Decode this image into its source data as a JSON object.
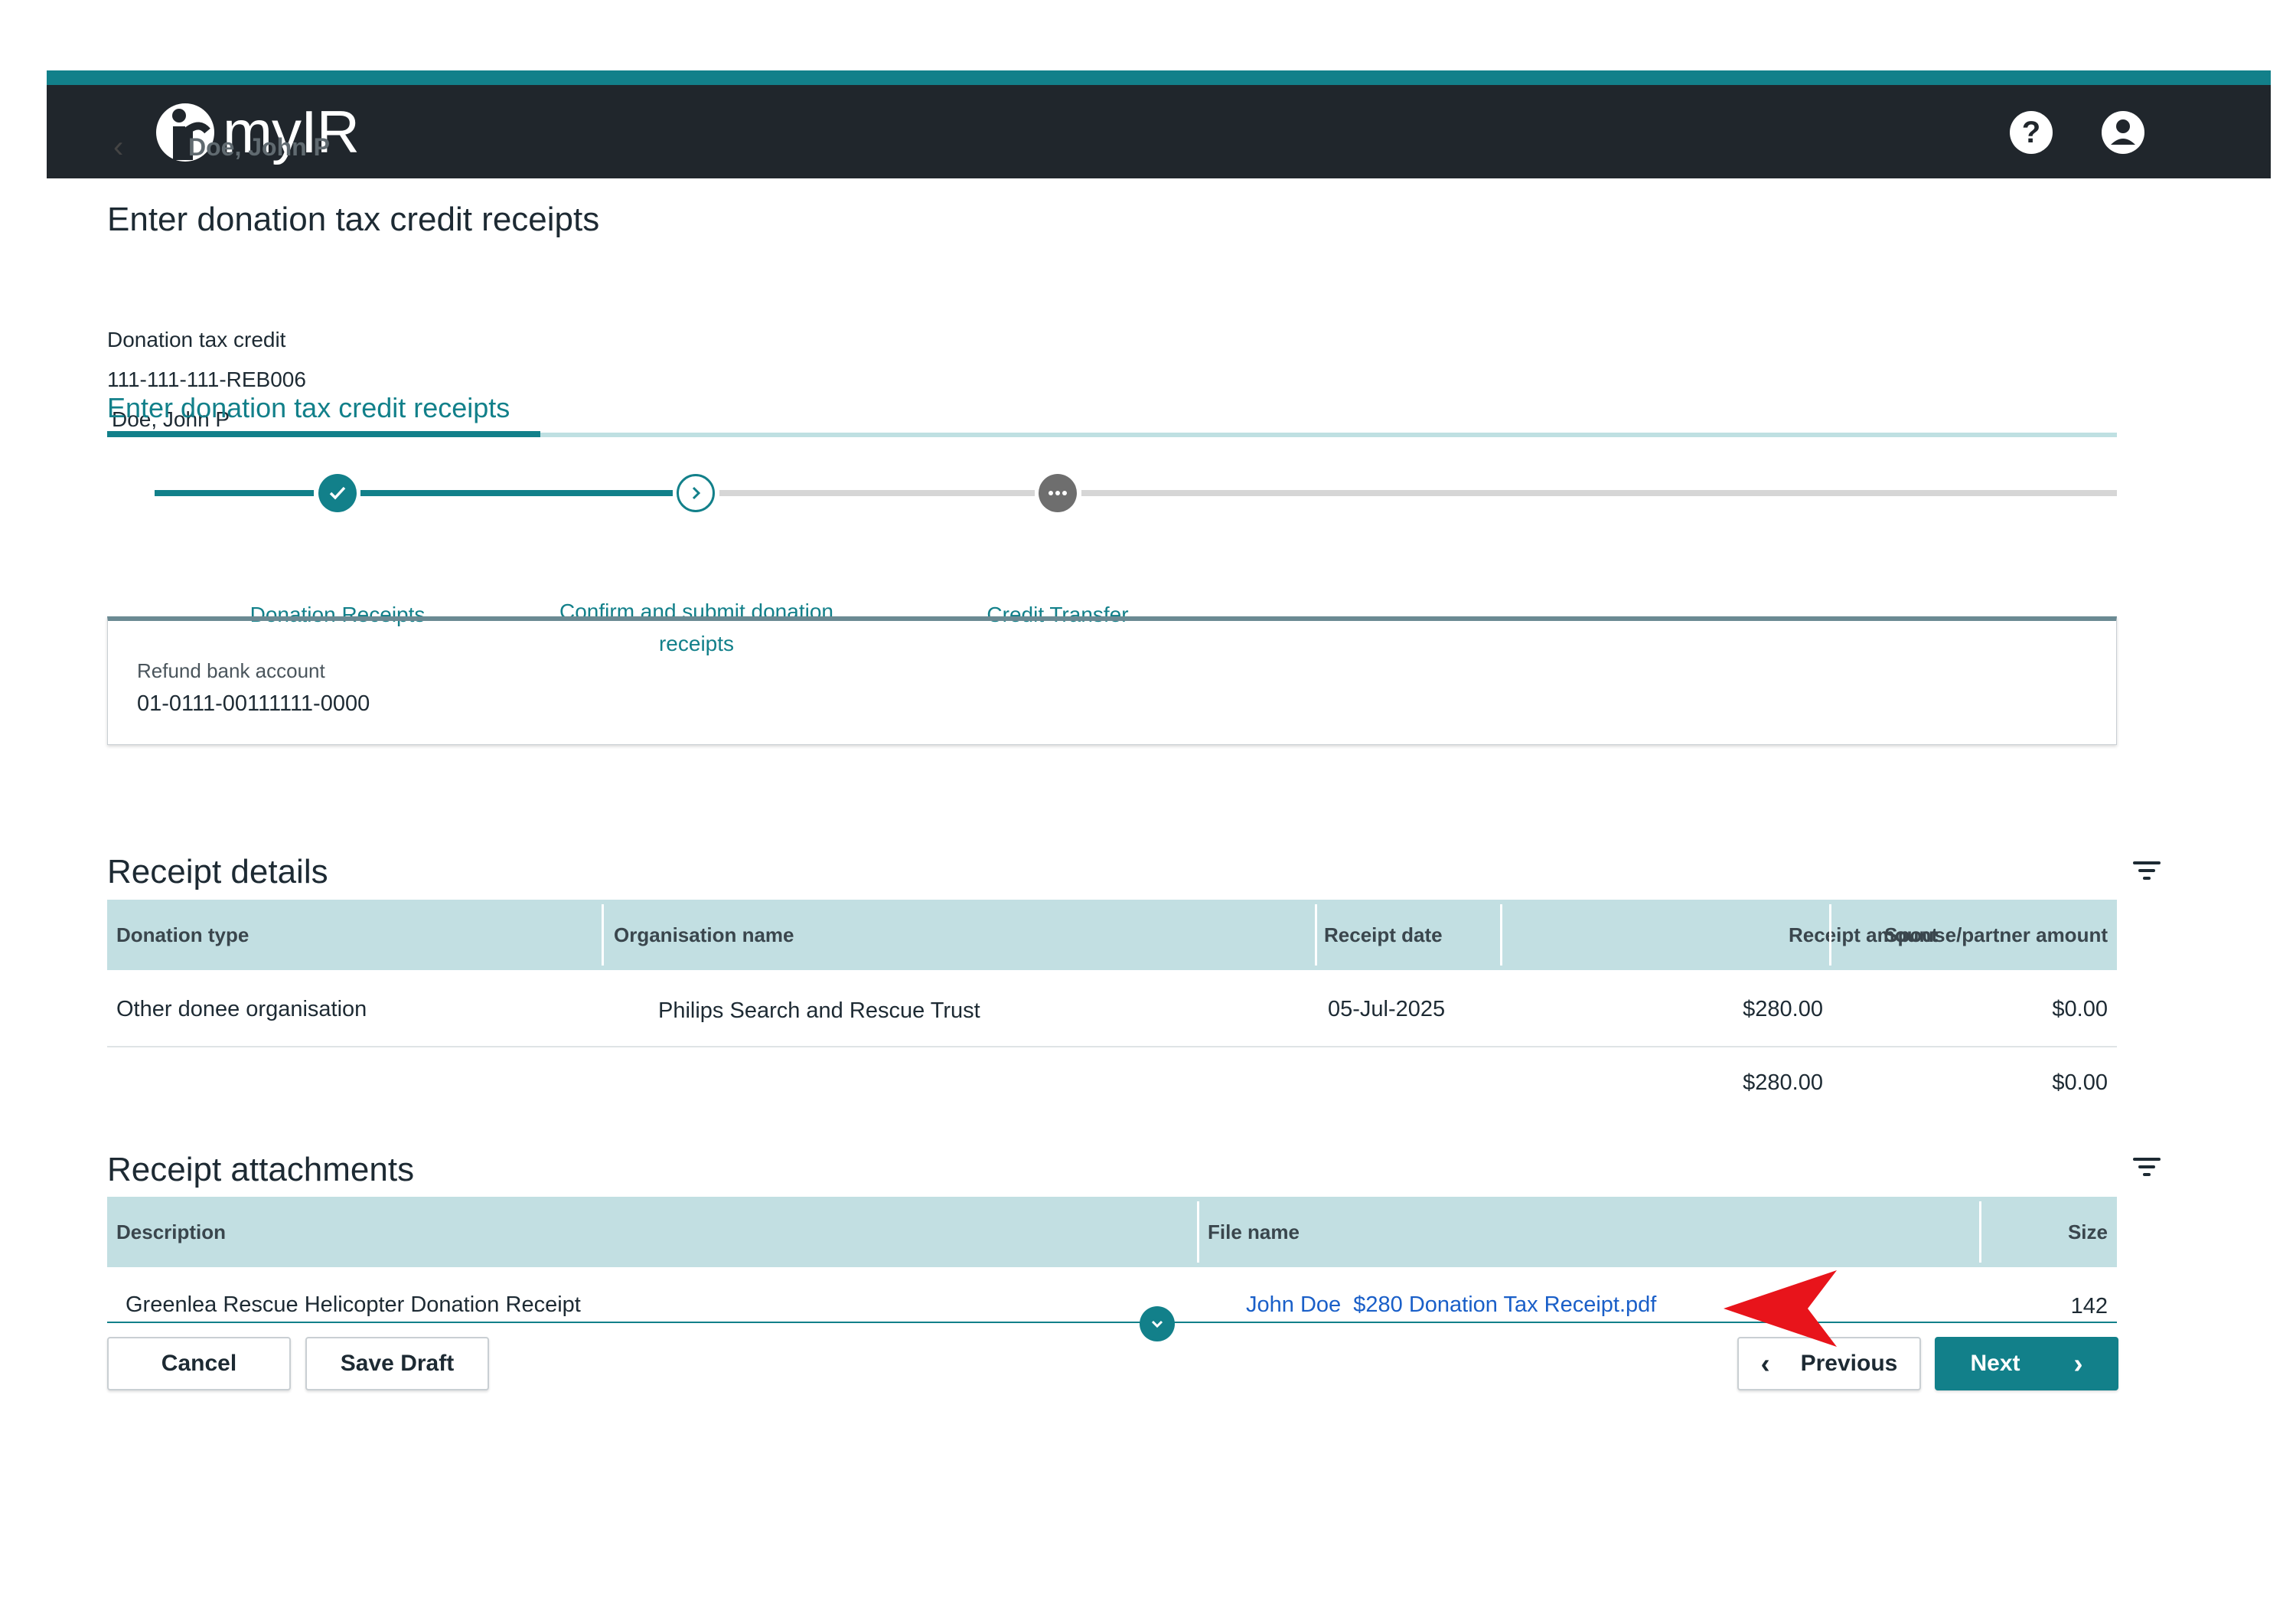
{
  "header": {
    "app_name": "myIR",
    "help_icon": "help-circle-icon",
    "account_icon": "account-circle-icon",
    "colors": {
      "bar": "#20262c",
      "accent": "#12808a"
    }
  },
  "breadcrumb": {
    "back_icon": "chevron-left-icon",
    "name": "Doe, John P"
  },
  "page": {
    "title": "Enter donation tax credit receipts",
    "subtitle": "Donation tax credit",
    "reference": "111-111-111-REB006",
    "customer": "Doe, John P"
  },
  "tab": {
    "label": "Enter donation tax credit receipts"
  },
  "steps": [
    {
      "label": "Donation Receipts",
      "state": "complete",
      "icon": "check-icon"
    },
    {
      "label": "Confirm and submit donation receipts",
      "state": "current",
      "icon": "chevron-right-icon"
    },
    {
      "label": "Credit Transfer",
      "state": "pending",
      "icon": "more-horizontal-icon"
    }
  ],
  "bank": {
    "label": "Refund bank account",
    "value": "01-0111-00111111-0000"
  },
  "receipt_details": {
    "title": "Receipt details",
    "filter_icon": "filter-icon",
    "columns": [
      "Donation type",
      "Organisation name",
      "Receipt date",
      "Receipt amount",
      "Spouse/partner amount"
    ],
    "rows": [
      [
        "Other donee organisation",
        "Philips Search and Rescue Trust",
        "05-Jul-2025",
        "$280.00",
        "$0.00"
      ]
    ],
    "totals": {
      "receipt_amount": "$280.00",
      "spouse_amount": "$0.00"
    }
  },
  "receipt_attachments": {
    "title": "Receipt attachments",
    "filter_icon": "filter-icon",
    "columns": [
      "Description",
      "File name",
      "Size"
    ],
    "rows": [
      [
        "Greenlea Rescue Helicopter Donation Receipt",
        "John Doe  $280 Donation Tax Receipt.pdf",
        "142"
      ]
    ]
  },
  "actions": {
    "cancel": "Cancel",
    "save_draft": "Save Draft",
    "previous": "Previous",
    "next": "Next"
  },
  "annotation": {
    "arrow_color": "#e8141b"
  }
}
